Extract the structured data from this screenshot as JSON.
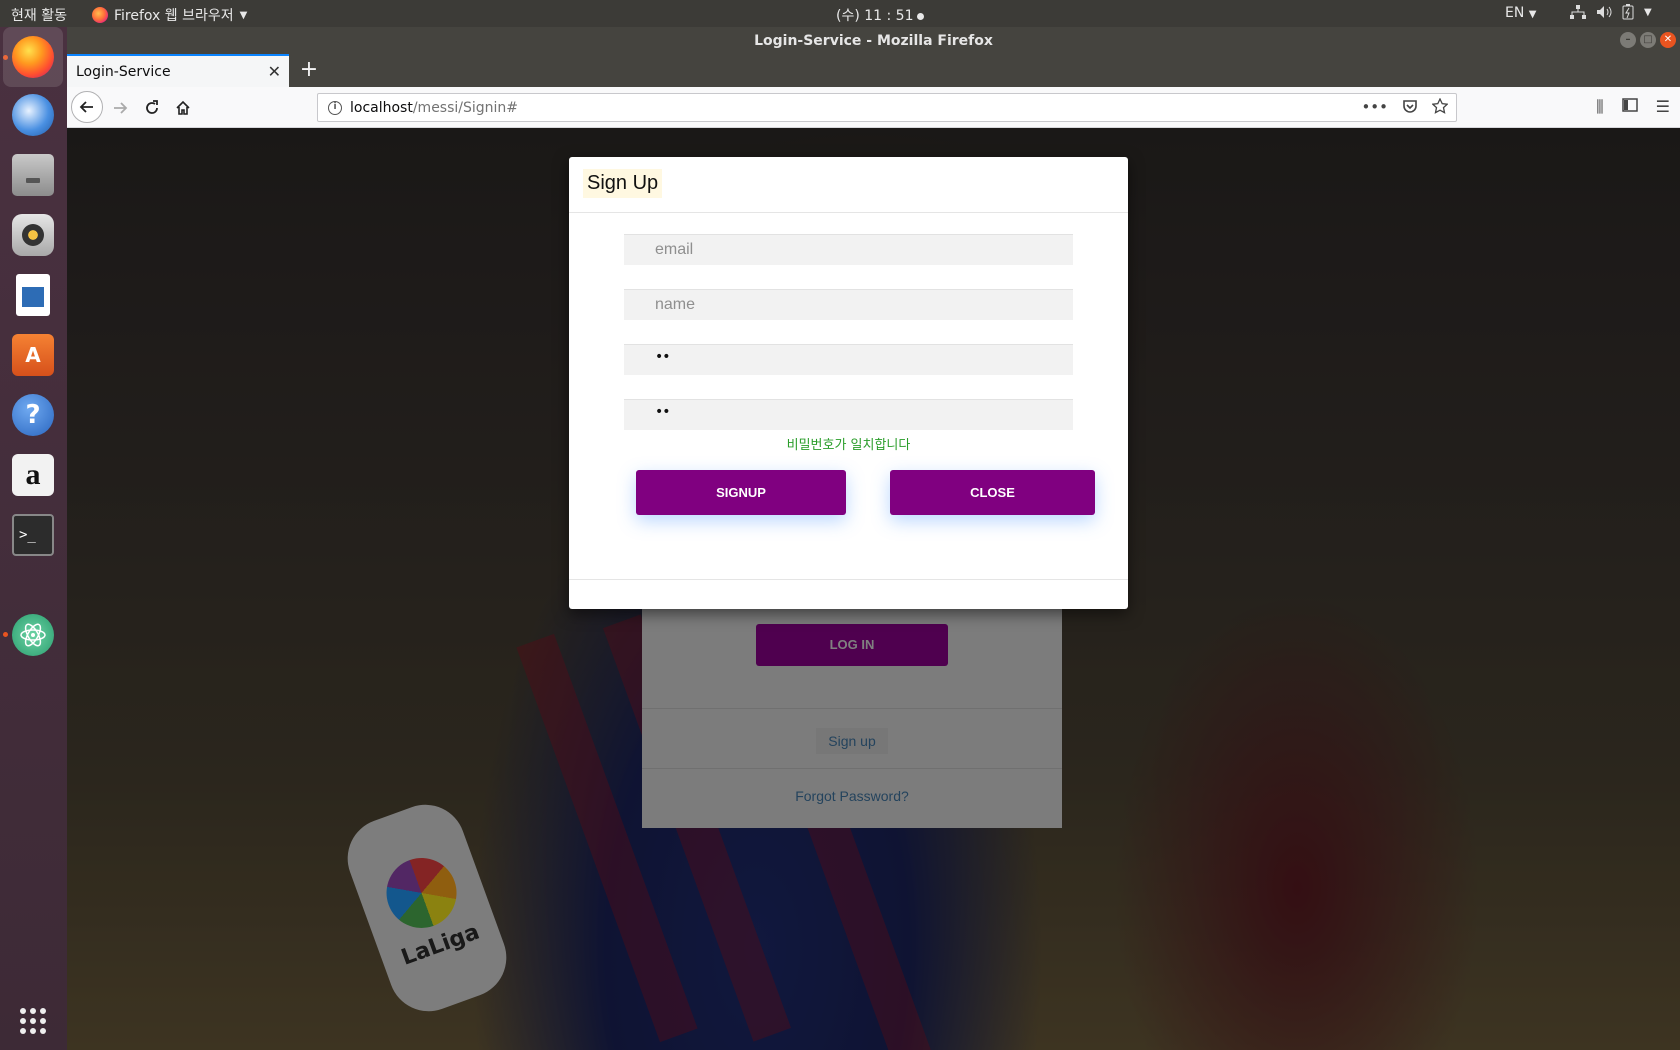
{
  "topbar": {
    "activities": "현재 활동",
    "app_menu": "Firefox 웹 브라우저",
    "clock": "(수) 11 : 51",
    "lang": "EN"
  },
  "dock": {
    "items": [
      "firefox",
      "thunderbird",
      "files",
      "rhythmbox",
      "libreoffice-writer",
      "ubuntu-software",
      "help",
      "amazon",
      "terminal",
      "atom",
      "show-apps"
    ]
  },
  "window": {
    "title": "Login-Service - Mozilla Firefox"
  },
  "browser": {
    "tab_title": "Login-Service",
    "url_host": "localhost",
    "url_path": "/messi/Signin#"
  },
  "login_card": {
    "login_button": "LOG IN",
    "signup_link": "Sign up",
    "forgot_link": "Forgot Password?"
  },
  "signup_modal": {
    "title": "Sign Up",
    "email_placeholder": "email",
    "name_placeholder": "name",
    "password_value": "••",
    "password_confirm_value": "••",
    "match_message": "비밀번호가 일치합니다",
    "signup_button": "SIGNUP",
    "close_button": "CLOSE"
  },
  "colors": {
    "accent_purple": "#800080",
    "match_green": "#2a9d2a",
    "ubuntu_orange": "#e95420"
  }
}
